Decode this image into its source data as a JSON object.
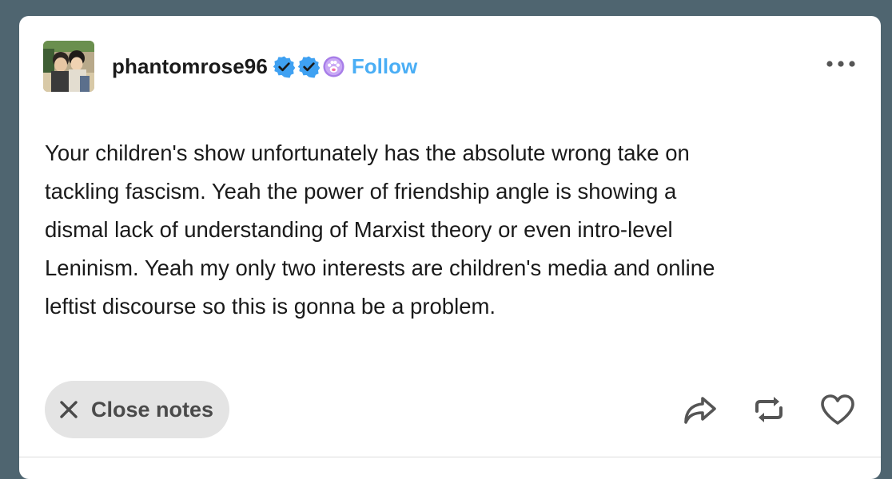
{
  "post": {
    "username": "phantomrose96",
    "follow_label": "Follow",
    "badges": [
      "verified-badge",
      "verified-badge",
      "paw-badge"
    ],
    "body_lines": [
      "Your children's show unfortunately has the absolute wrong take on",
      "tackling fascism. Yeah the power of friendship angle is showing a",
      "dismal lack of understanding of Marxist theory or even intro-level",
      "Leninism. Yeah my only two interests are children's media and online",
      "leftist discourse so this is gonna be a problem."
    ]
  },
  "footer": {
    "close_notes_label": "Close notes",
    "icons": [
      "share-icon",
      "reblog-icon",
      "like-icon"
    ]
  },
  "colors": {
    "background": "#4f6570",
    "follow": "#4aaef5",
    "badge_blue": "#3fa1f2",
    "paw_purple": "#a77de8",
    "pill_bg": "#e4e4e4"
  }
}
